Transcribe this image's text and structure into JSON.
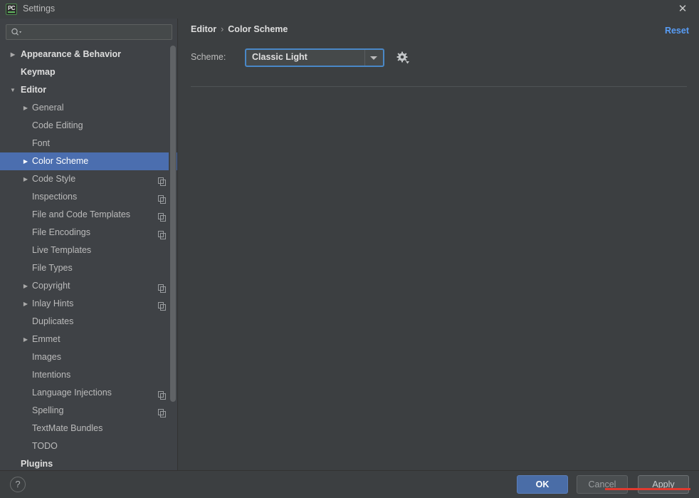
{
  "window": {
    "title": "Settings",
    "app_icon": "pycharm-icon",
    "close_icon": "✕"
  },
  "sidebar": {
    "search": {
      "value": "",
      "placeholder": "",
      "icon": "search-icon"
    },
    "items": [
      {
        "label": "Appearance & Behavior",
        "level": 0,
        "arrow": "collapsed",
        "top": true,
        "copy": false,
        "selected": false
      },
      {
        "label": "Keymap",
        "level": 0,
        "arrow": "none",
        "top": true,
        "copy": false,
        "selected": false
      },
      {
        "label": "Editor",
        "level": 0,
        "arrow": "expanded",
        "top": true,
        "copy": false,
        "selected": false
      },
      {
        "label": "General",
        "level": 1,
        "arrow": "collapsed",
        "top": false,
        "copy": false,
        "selected": false
      },
      {
        "label": "Code Editing",
        "level": 1,
        "arrow": "none",
        "top": false,
        "copy": false,
        "selected": false
      },
      {
        "label": "Font",
        "level": 1,
        "arrow": "none",
        "top": false,
        "copy": false,
        "selected": false
      },
      {
        "label": "Color Scheme",
        "level": 1,
        "arrow": "collapsed",
        "top": false,
        "copy": false,
        "selected": true
      },
      {
        "label": "Code Style",
        "level": 1,
        "arrow": "collapsed",
        "top": false,
        "copy": true,
        "selected": false
      },
      {
        "label": "Inspections",
        "level": 1,
        "arrow": "none",
        "top": false,
        "copy": true,
        "selected": false
      },
      {
        "label": "File and Code Templates",
        "level": 1,
        "arrow": "none",
        "top": false,
        "copy": true,
        "selected": false
      },
      {
        "label": "File Encodings",
        "level": 1,
        "arrow": "none",
        "top": false,
        "copy": true,
        "selected": false
      },
      {
        "label": "Live Templates",
        "level": 1,
        "arrow": "none",
        "top": false,
        "copy": false,
        "selected": false
      },
      {
        "label": "File Types",
        "level": 1,
        "arrow": "none",
        "top": false,
        "copy": false,
        "selected": false
      },
      {
        "label": "Copyright",
        "level": 1,
        "arrow": "collapsed",
        "top": false,
        "copy": true,
        "selected": false
      },
      {
        "label": "Inlay Hints",
        "level": 1,
        "arrow": "collapsed",
        "top": false,
        "copy": true,
        "selected": false
      },
      {
        "label": "Duplicates",
        "level": 1,
        "arrow": "none",
        "top": false,
        "copy": false,
        "selected": false
      },
      {
        "label": "Emmet",
        "level": 1,
        "arrow": "collapsed",
        "top": false,
        "copy": false,
        "selected": false
      },
      {
        "label": "Images",
        "level": 1,
        "arrow": "none",
        "top": false,
        "copy": false,
        "selected": false
      },
      {
        "label": "Intentions",
        "level": 1,
        "arrow": "none",
        "top": false,
        "copy": false,
        "selected": false
      },
      {
        "label": "Language Injections",
        "level": 1,
        "arrow": "none",
        "top": false,
        "copy": true,
        "selected": false
      },
      {
        "label": "Spelling",
        "level": 1,
        "arrow": "none",
        "top": false,
        "copy": true,
        "selected": false
      },
      {
        "label": "TextMate Bundles",
        "level": 1,
        "arrow": "none",
        "top": false,
        "copy": false,
        "selected": false
      },
      {
        "label": "TODO",
        "level": 1,
        "arrow": "none",
        "top": false,
        "copy": false,
        "selected": false
      },
      {
        "label": "Plugins",
        "level": 0,
        "arrow": "none",
        "top": true,
        "copy": false,
        "selected": false
      }
    ]
  },
  "main": {
    "breadcrumb": {
      "parent": "Editor",
      "separator": "›",
      "current": "Color Scheme"
    },
    "reset_label": "Reset",
    "scheme": {
      "label": "Scheme:",
      "value": "Classic Light",
      "options": [
        "Classic Light"
      ],
      "gear_icon": "gear-icon"
    }
  },
  "bottom": {
    "help_label": "?",
    "ok_label": "OK",
    "cancel_label": "Cancel",
    "apply_mnemonic": "A",
    "apply_rest": "pply"
  },
  "colors": {
    "window_bg": "#3c3f41",
    "sidebar_bg": "#3f4246",
    "selection": "#4b6eaf",
    "link": "#589df6",
    "focus_ring": "#4a88c7",
    "default_button": "#4a6da7",
    "annotation_red": "#e03a2f",
    "text": "#bbbbbb"
  }
}
